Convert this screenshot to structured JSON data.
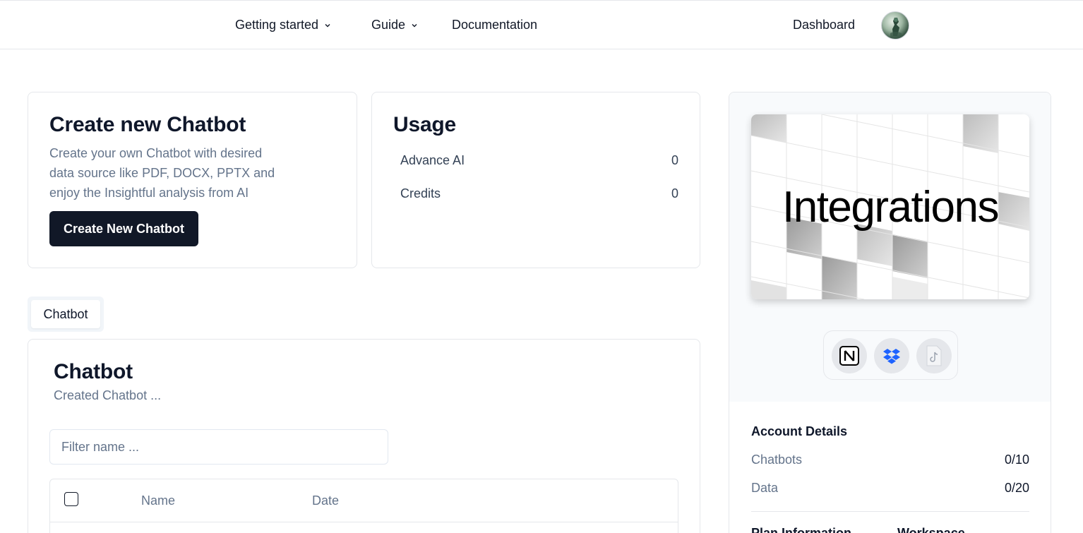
{
  "nav": {
    "getting_started": "Getting started",
    "guide": "Guide",
    "documentation": "Documentation",
    "dashboard": "Dashboard"
  },
  "create_card": {
    "title": "Create new Chatbot",
    "description_lines": [
      "Create your own Chatbot with desired",
      "data source like PDF, DOCX, PPTX and",
      "enjoy the Insightful analysis from AI"
    ],
    "button_label": "Create New Chatbot"
  },
  "usage_card": {
    "title": "Usage",
    "rows": [
      {
        "label": "Advance AI",
        "value": "0"
      },
      {
        "label": "Credits",
        "value": "0"
      }
    ]
  },
  "tabs": [
    {
      "label": "Chatbot",
      "active": true
    }
  ],
  "chatbot_panel": {
    "title": "Chatbot",
    "subtitle": "Created Chatbot ...",
    "filter_placeholder": "Filter name ...",
    "filter_value": "",
    "columns": [
      "Name",
      "Date"
    ]
  },
  "integrations": {
    "banner_text": "Integrations",
    "icons": [
      "notion-icon",
      "dropbox-icon",
      "tiktok-icon"
    ]
  },
  "account": {
    "title": "Account Details",
    "rows": [
      {
        "label": "Chatbots",
        "value": "0/10"
      },
      {
        "label": "Data",
        "value": "0/20"
      }
    ],
    "plan_information": "Plan Information",
    "workspace": "Workspace"
  },
  "colors": {
    "primary_dark": "#111827",
    "muted_text": "#64748b",
    "border": "#e5e7eb",
    "dropbox_blue": "#1e63ff"
  }
}
